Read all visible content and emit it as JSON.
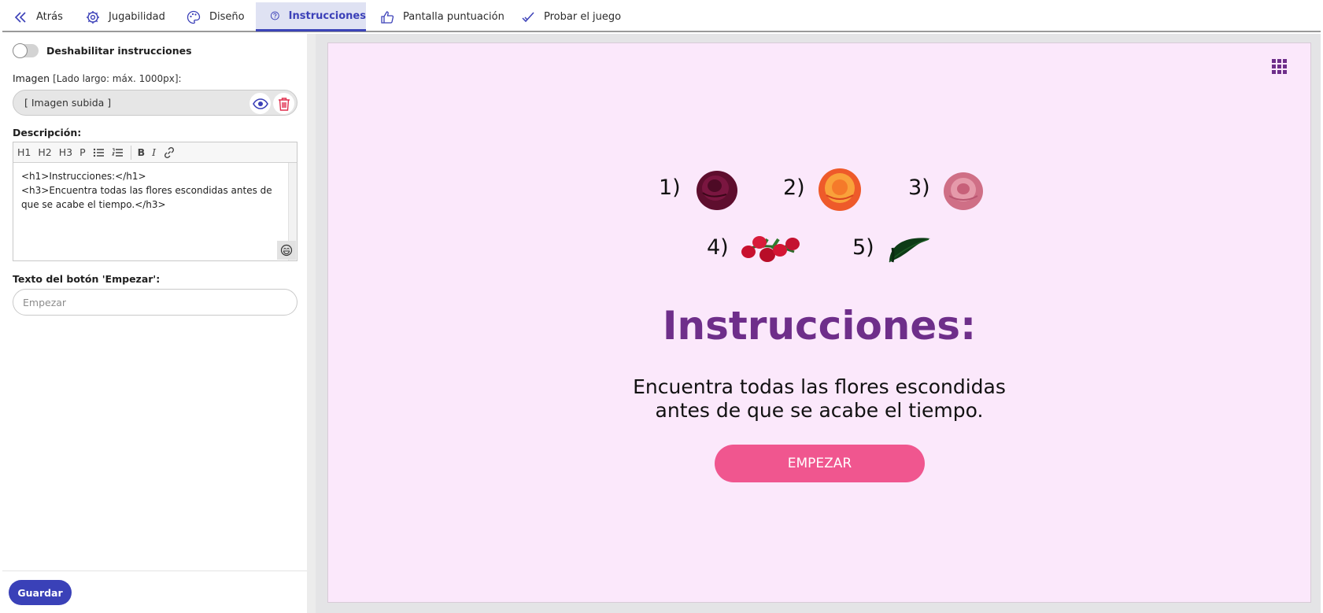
{
  "nav": {
    "tabs": [
      {
        "label": "Atrás",
        "icon": "double-chevron-left-icon"
      },
      {
        "label": "Jugabilidad",
        "icon": "gear-icon"
      },
      {
        "label": "Diseño",
        "icon": "palette-icon"
      },
      {
        "label": "Instrucciones",
        "icon": "help-circle-icon",
        "active": true
      },
      {
        "label": "Pantalla puntuación",
        "icon": "thumbs-up-icon"
      },
      {
        "label": "Probar el juego",
        "icon": "check-icon"
      }
    ]
  },
  "left": {
    "toggle_label": "Deshabilitar instrucciones",
    "toggle_on": false,
    "image_label": "Imagen",
    "image_hint": "[Lado largo: máx. 1000px]:",
    "image_value": "[ Imagen subida ]",
    "description_label": "Descripción:",
    "toolbar": {
      "h1": "H1",
      "h2": "H2",
      "h3": "H3",
      "p": "P",
      "bold": "B",
      "italic": "I"
    },
    "description_lines": [
      "<h1>Instrucciones:</h1>",
      "<h3>Encuentra todas las flores escondidas antes de que se acabe el tiempo.</h3>"
    ],
    "start_label": "Texto del botón 'Empezar':",
    "start_placeholder": "Empezar",
    "save_label": "Guardar"
  },
  "preview": {
    "items": [
      {
        "num": "1)",
        "name": "dark-red-rose"
      },
      {
        "num": "2)",
        "name": "orange-rose"
      },
      {
        "num": "3)",
        "name": "pink-rose"
      },
      {
        "num": "4)",
        "name": "red-berries"
      },
      {
        "num": "5)",
        "name": "green-leaf"
      }
    ],
    "title": "Instrucciones:",
    "description_line1": "Encuentra todas las flores escondidas",
    "description_line2": "antes de que se acabe el tiempo.",
    "start_button": "EMPEZAR"
  },
  "colors": {
    "accent": "#3a41b8",
    "title": "#6e2e8a",
    "preview_bg": "#fbe8fb",
    "start_button": "#f0568f"
  }
}
